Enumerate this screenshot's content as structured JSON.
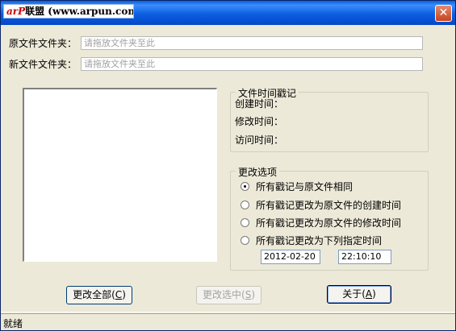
{
  "window": {
    "title_logo_brand": "arP",
    "title_logo_text": "联盟 (www.arpun.com)",
    "close_glyph": "✕"
  },
  "paths": {
    "source_label": "原文件文件夹：",
    "source_placeholder": "请拖放文件夹至此",
    "target_label": "新文件文件夹：",
    "target_placeholder": "请拖放文件夹至此"
  },
  "timestamps": {
    "group_title": "文件时间戳记",
    "created_label": "创建时间：",
    "modified_label": "修改时间：",
    "accessed_label": "访问时间："
  },
  "options": {
    "group_title": "更改选项",
    "radios": [
      {
        "label": "所有戳记与原文件相同",
        "checked": true
      },
      {
        "label": "所有戳记更改为原文件的创建时间",
        "checked": false
      },
      {
        "label": "所有戳记更改为原文件的修改时间",
        "checked": false
      },
      {
        "label": "所有戳记更改为下列指定时间",
        "checked": false
      }
    ],
    "date_value": "2012-02-20",
    "time_value": "22:10:10"
  },
  "buttons": {
    "change_all_text": "更改全部(",
    "change_all_key": "C",
    "change_sel_text": "更改选中(",
    "change_sel_key": "S",
    "about_text": "关于(",
    "about_key": "A",
    "close_paren": ")"
  },
  "status": {
    "text": "就绪"
  }
}
